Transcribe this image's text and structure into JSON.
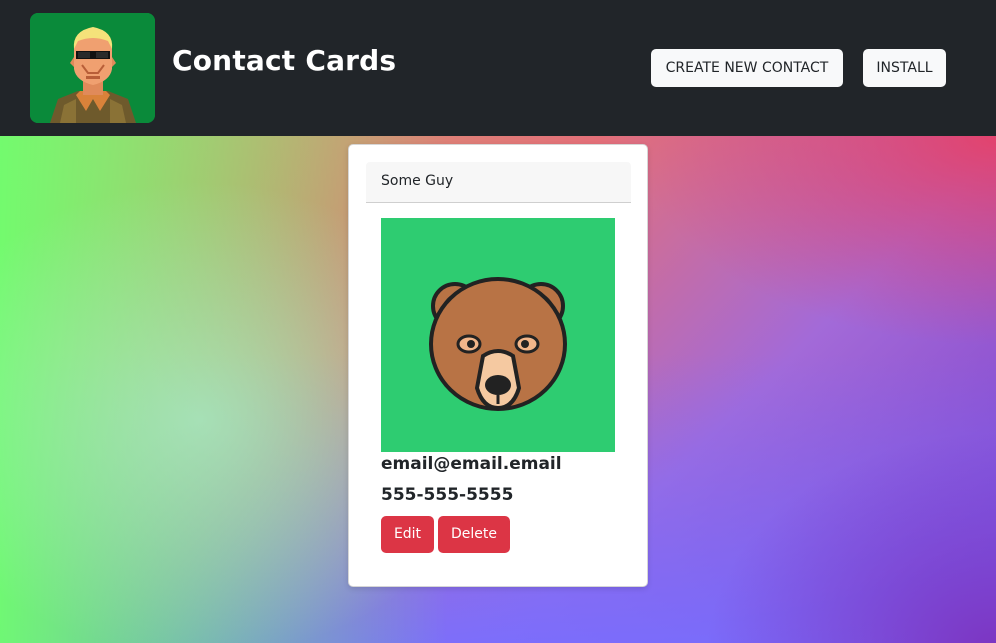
{
  "header": {
    "title": "Contact Cards",
    "logo_icon": "pixel-art-commando-portrait-icon",
    "buttons": {
      "create": "CREATE NEW CONTACT",
      "install": "INSTALL"
    }
  },
  "contact": {
    "name": "Some Guy",
    "avatar_icon": "bear-face-icon",
    "email": "email@email.email",
    "phone": "555-555-5555",
    "actions": {
      "edit": "Edit",
      "delete": "Delete"
    }
  },
  "colors": {
    "header_bg": "#212529",
    "danger": "#dc3545",
    "avatar_bg": "#2ecc71",
    "logo_bg": "#0a8a3a"
  }
}
